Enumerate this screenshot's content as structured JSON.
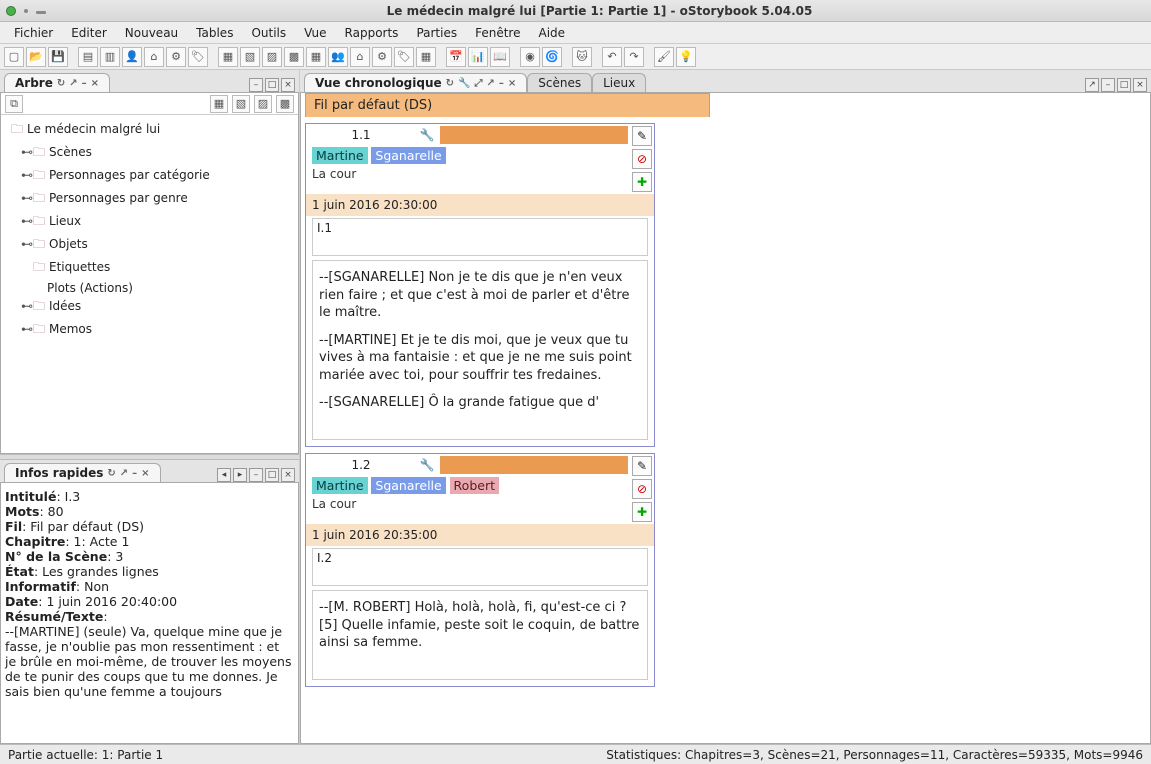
{
  "window": {
    "title": "Le médecin malgré lui [Partie 1: Partie 1] - oStorybook 5.04.05"
  },
  "menubar": [
    "Fichier",
    "Editer",
    "Nouveau",
    "Tables",
    "Outils",
    "Vue",
    "Rapports",
    "Parties",
    "Fenêtre",
    "Aide"
  ],
  "panels": {
    "arbre": {
      "title": "Arbre"
    },
    "infos": {
      "title": "Infos rapides"
    },
    "chrono": {
      "title": "Vue chronologique"
    },
    "scenes_tab": "Scènes",
    "lieux_tab": "Lieux"
  },
  "tree": {
    "root": "Le médecin malgré lui",
    "nodes": [
      "Scènes",
      "Personnages par catégorie",
      "Personnages par genre",
      "Lieux",
      "Objets",
      "Etiquettes",
      "Plots (Actions)",
      "Idées",
      "Memos"
    ]
  },
  "infos": {
    "intitule_label": "Intitulé",
    "intitule": "I.3",
    "mots_label": "Mots",
    "mots": "80",
    "fil_label": "Fil",
    "fil": "Fil par défaut (DS)",
    "chapitre_label": "Chapitre",
    "chapitre": "1: Acte 1",
    "numscene_label": "N° de la Scène",
    "numscene": "3",
    "etat_label": "État",
    "etat": "Les grandes lignes",
    "informatif_label": "Informatif",
    "informatif": "Non",
    "date_label": "Date",
    "date": "1 juin 2016 20:40:00",
    "resume_label": "Résumé/Texte",
    "resume": "--[MARTINE] (seule) Va, quelque mine que je fasse, je n'oublie pas mon ressentiment : et je brûle en moi-même, de trouver les moyens de te punir des coups que tu me donnes. Je sais bien qu'une femme a toujours"
  },
  "chrono": {
    "thread_label": "Fil par défaut (DS)",
    "scenes": [
      {
        "num": "1.1",
        "chars": [
          "Martine",
          "Sganarelle"
        ],
        "location": "La cour",
        "date": "1 juin 2016 20:30:00",
        "slot": "I.1",
        "paras": [
          "--[SGANARELLE] Non je te dis que je n'en veux rien faire ; et que c'est à moi de parler et d'être le maître.",
          "--[MARTINE] Et je te dis moi, que je veux que tu vives à ma fantaisie : et que je ne me suis point mariée avec toi, pour souffrir tes fredaines.",
          "--[SGANARELLE] Ô la grande fatigue que d'"
        ]
      },
      {
        "num": "1.2",
        "chars": [
          "Martine",
          "Sganarelle",
          "Robert"
        ],
        "location": "La cour",
        "date": "1 juin 2016 20:35:00",
        "slot": "I.2",
        "paras": [
          "--[M. ROBERT] Holà, holà, holà, fi, qu'est-ce ci ? [5] Quelle infamie, peste soit le coquin, de battre ainsi sa femme."
        ]
      }
    ]
  },
  "statusbar": {
    "left": "Partie actuelle: 1: Partie 1",
    "right": "Statistiques: Chapitres=3,  Scènes=21,  Personnages=11,  Caractères=59335,  Mots=9946"
  }
}
